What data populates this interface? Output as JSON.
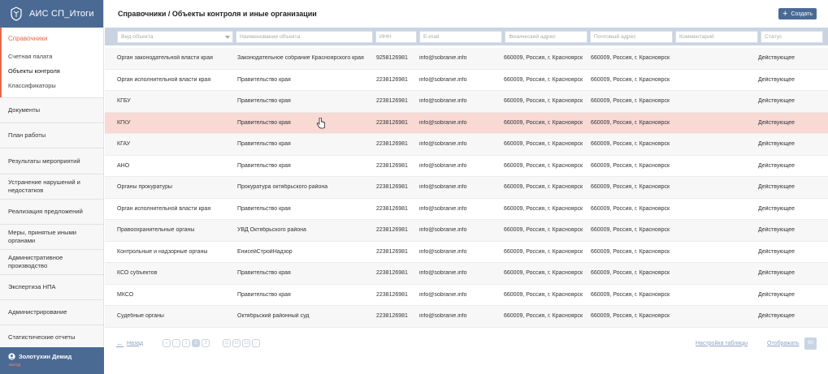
{
  "app": {
    "title": "АИС СП_Итоги"
  },
  "sidebar": {
    "active_section": "Справочники",
    "sub_items": [
      "Счетная палата",
      "Объекты контроля",
      "Классификаторы"
    ],
    "items": [
      "Документы",
      "План работы",
      "Результаты мероприятий",
      "Устранение нарушений и недостатков",
      "Реализация предложений",
      "Меры, принятые иными органами",
      "Административное производство",
      "Экспертиза НПА",
      "Администрирование",
      "Статистические отчеты"
    ]
  },
  "user": {
    "name": "Золотухин Демид",
    "logout": "выход"
  },
  "header": {
    "title": "Справочники / Объекты контроля и иные организации",
    "create_label": "Создать"
  },
  "filters": {
    "type": "Вид объекта",
    "name": "Наименование объекта",
    "inn": "ИНН",
    "email": "E-mail",
    "phys": "Физический адрес",
    "post": "Почтовый адрес",
    "comment": "Комментарий",
    "status": "Статус"
  },
  "rows": [
    [
      "Орган законодательной власти края",
      "Законодательное собрание Красноярского края",
      "9258126981",
      "info@sobranie.info",
      "660009, Россия, г. Красноярск",
      "660009, Россия, г. Красноярск",
      "",
      "Действующее"
    ],
    [
      "Орган исполнительной власти края",
      "Правительство края",
      "2238126981",
      "info@sobranie.info",
      "660009, Россия, г. Красноярск",
      "660009, Россия, г. Красноярск",
      "",
      "Действующее"
    ],
    [
      "КГБУ",
      "Правительство края",
      "2238126981",
      "info@sobranie.info",
      "660009, Россия, г. Красноярск",
      "660009, Россия, г. Красноярск",
      "",
      "Действующее"
    ],
    [
      "КГКУ",
      "Правительство края",
      "2238126981",
      "info@sobranie.info",
      "660009, Россия, г. Красноярск",
      "660009, Россия, г. Красноярск",
      "",
      "Действующее"
    ],
    [
      "КГАУ",
      "Правительство края",
      "2238126981",
      "info@sobranie.info",
      "660009, Россия, г. Красноярск",
      "660009, Россия, г. Красноярск",
      "",
      "Действующее"
    ],
    [
      "АНО",
      "Правительство края",
      "2238126981",
      "info@sobranie.info",
      "660009, Россия, г. Красноярск",
      "660009, Россия, г. Красноярск",
      "",
      "Действующее"
    ],
    [
      "Органы прокуратуры",
      "Прокуратура октябрьского района",
      "2238126981",
      "info@sobranie.info",
      "660009, Россия, г. Красноярск",
      "660009, Россия, г. Красноярск",
      "",
      "Действующее"
    ],
    [
      "Орган исполнительной власти края",
      "Правительство края",
      "2238126981",
      "info@sobranie.info",
      "660009, Россия, г. Красноярск",
      "660009, Россия, г. Красноярск",
      "",
      "Действующее"
    ],
    [
      "Правоохранительные органы",
      "УВД Октябрьского района",
      "2238126981",
      "info@sobranie.info",
      "660009, Россия, г. Красноярск",
      "660009, Россия, г. Красноярск",
      "",
      "Действующее"
    ],
    [
      "Контрольные и надзорные органы",
      "ЕнисейСтройНадзор",
      "2238126981",
      "info@sobranie.info",
      "660009, Россия, г. Красноярск",
      "660009, Россия, г. Красноярск",
      "",
      "Действующее"
    ],
    [
      "КСО субъектов",
      "Правительство края",
      "2238126981",
      "info@sobranie.info",
      "660009, Россия, г. Красноярск",
      "660009, Россия, г. Красноярск",
      "",
      "Действующее"
    ],
    [
      "МКСО",
      "Правительство края",
      "2238126981",
      "info@sobranie.info",
      "660009, Россия, г. Красноярск",
      "660009, Россия, г. Красноярск",
      "",
      "Действующее"
    ],
    [
      "Судебные органы",
      "Октябрьский районный суд",
      "2238126981",
      "info@sobranie.info",
      "660009, Россия, г. Красноярск",
      "660009, Россия, г. Красноярск",
      "",
      "Действующее"
    ]
  ],
  "highlighted_row": 3,
  "pager": {
    "back": "Назад",
    "pages": [
      "1",
      "2",
      "3",
      "11",
      "12",
      "13"
    ],
    "current_page": "2",
    "settings": "Настройка таблицы",
    "show": "Отображать",
    "show_count": "50"
  },
  "colors": {
    "brand": "#4a6a94",
    "accent": "#e8694a",
    "highlight": "#f8d9d3",
    "filter_bar": "#c9d4e3"
  }
}
